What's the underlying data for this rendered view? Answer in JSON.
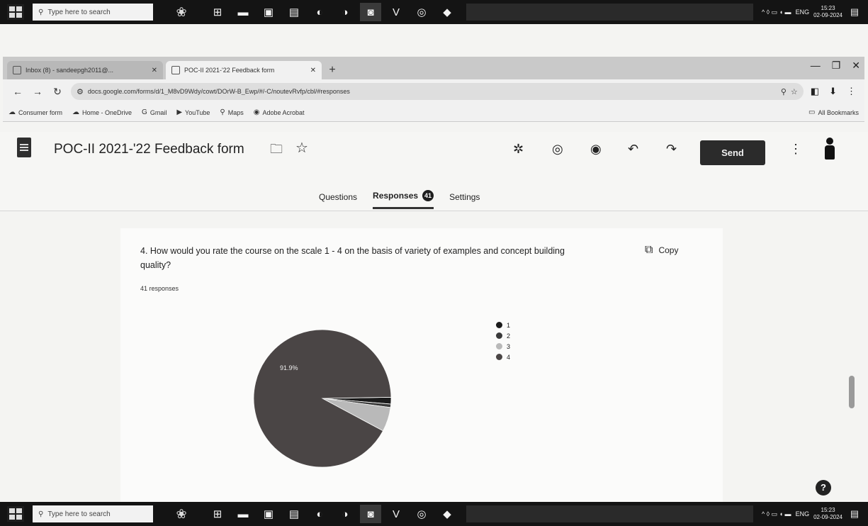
{
  "taskbar": {
    "search_placeholder": "Type here to search",
    "apps": [
      "⊞",
      "▬",
      "▣",
      "▤",
      "◐",
      "◑",
      "◙",
      "V",
      "◎",
      "◆"
    ],
    "tray_icons": "^ ◊ ▭ ◖ ▬",
    "lang": "ENG",
    "time": "15:23",
    "date": "02-09-2024"
  },
  "browser": {
    "tabs": [
      {
        "title": "Inbox (8) - sandeepgh2011@...",
        "active": false
      },
      {
        "title": "POC-II 2021-'22 Feedback form",
        "active": true
      }
    ],
    "url": "docs.google.com/forms/d/1_M8vD9Wdy/cowt/DOrW-B_Ewp/#/-C/noutevRvfp/cbl/#responses",
    "bookmarks": [
      {
        "icon": "☁",
        "label": "Consumer form"
      },
      {
        "icon": "☁",
        "label": "Home - OneDrive"
      },
      {
        "icon": "G",
        "label": "Gmail"
      },
      {
        "icon": "▶",
        "label": "YouTube"
      },
      {
        "icon": "⚲",
        "label": "Maps"
      },
      {
        "icon": "◉",
        "label": "Adobe Acrobat"
      }
    ],
    "all_bookmarks": "All Bookmarks"
  },
  "form": {
    "title": "POC-II 2021-'22 Feedback form",
    "send_label": "Send",
    "tabs": {
      "questions": "Questions",
      "responses": "Responses",
      "responses_badge": "41",
      "settings": "Settings"
    }
  },
  "question": {
    "text": "4.   How would you rate the course on the scale 1 - 4 on the basis of variety of examples and concept building quality?",
    "copy_label": "Copy",
    "response_count": "41 responses"
  },
  "chart_data": {
    "type": "pie",
    "title": "",
    "slices": [
      {
        "label": "1",
        "value": 1.6,
        "color": "#1b1b1b"
      },
      {
        "label": "2",
        "value": 0.8,
        "color": "#3a3a3a"
      },
      {
        "label": "3",
        "value": 5.7,
        "color": "#b9b9b9"
      },
      {
        "label": "4",
        "value": 91.9,
        "color": "#4a4545"
      }
    ],
    "data_labels": [
      "91.9%"
    ],
    "legend_position": "right"
  }
}
